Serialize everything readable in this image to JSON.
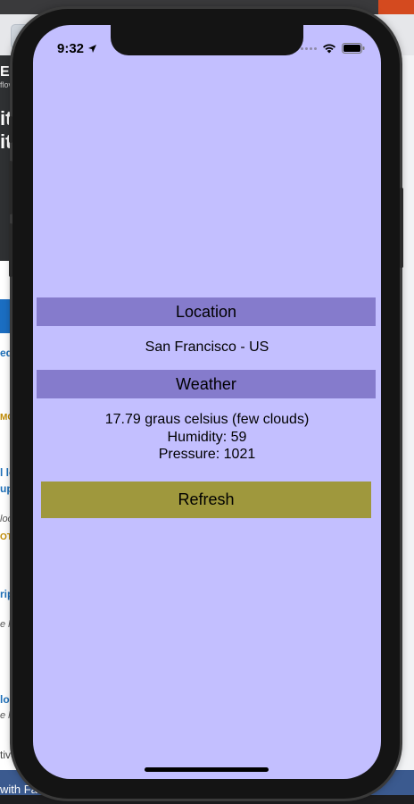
{
  "status_bar": {
    "time": "9:32"
  },
  "location_section": {
    "header": "Location",
    "value": "San Francisco - US"
  },
  "weather_section": {
    "header": "Weather",
    "description": "17.79 graus celsius (few clouds)",
    "humidity": "Humidity: 59",
    "pressure": "Pressure: 1021"
  },
  "actions": {
    "refresh_label": "Refresh"
  },
  "colors": {
    "screen_background": "#c3bfff",
    "header_background": "#857bcc",
    "button_background": "#9f983d"
  },
  "background_page": {
    "fragments": [
      "ES",
      "flov",
      "itl",
      "it",
      "ed",
      "MO",
      "l le",
      "up",
      "loca",
      "OT",
      "ript",
      "e lo",
      "lop",
      "e lo",
      "tive",
      "with Fac"
    ]
  }
}
